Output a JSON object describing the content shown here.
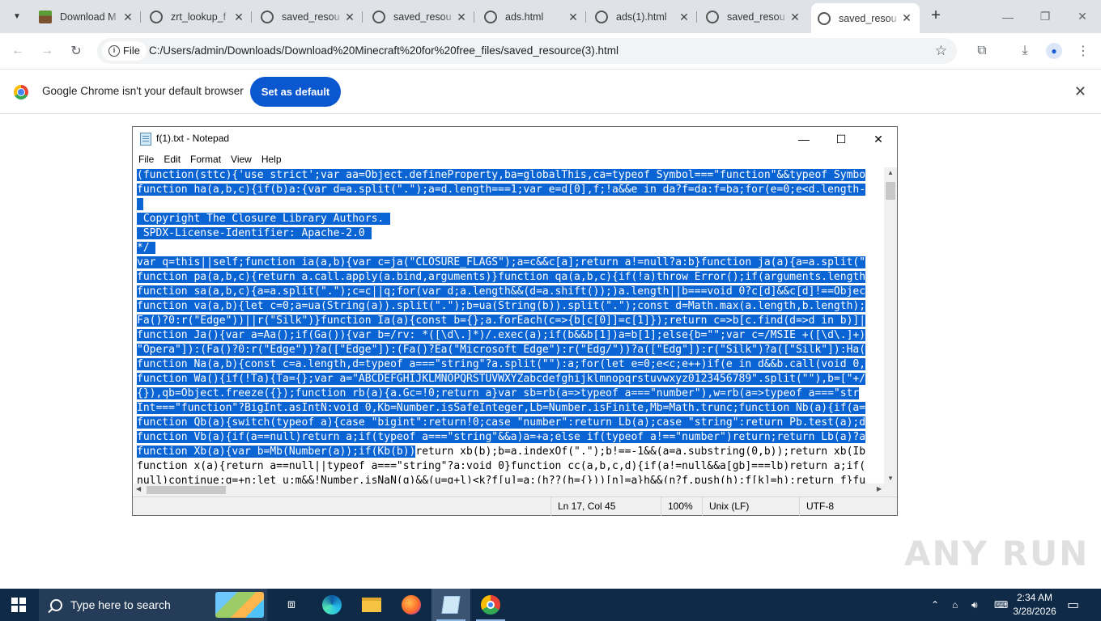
{
  "browser": {
    "tabs": [
      {
        "title": "Download M",
        "icon": "minecraft-icon"
      },
      {
        "title": "zrt_lookup_f",
        "icon": "globe-icon"
      },
      {
        "title": "saved_resou",
        "icon": "globe-icon"
      },
      {
        "title": "saved_resou",
        "icon": "globe-icon"
      },
      {
        "title": "ads.html",
        "icon": "globe-icon"
      },
      {
        "title": "ads(1).html",
        "icon": "globe-icon"
      },
      {
        "title": "saved_resou",
        "icon": "globe-icon"
      },
      {
        "title": "saved_resou",
        "icon": "globe-icon",
        "active": true
      }
    ],
    "omnibox": {
      "scheme_label": "File",
      "url": "C:/Users/admin/Downloads/Download%20Minecraft%20for%20free_files/saved_resource(3).html"
    },
    "infobar": {
      "message": "Google Chrome isn't your default browser",
      "button": "Set as default"
    }
  },
  "notepad": {
    "title": "f(1).txt - Notepad",
    "menu": [
      "File",
      "Edit",
      "Format",
      "View",
      "Help"
    ],
    "lines": [
      {
        "sel": "(function(sttc){'use strict';var aa=Object.defineProperty,ba=globalThis,ca=typeof Symbol===\"function\"&&typeof Symbo",
        "rest": ""
      },
      {
        "sel": "function ha(a,b,c){if(b)a:{var d=a.split(\".\");a=d.length===1;var e=d[0],f;!a&&e in da?f=da:f=ba;for(e=0;e<d.length-",
        "rest": ""
      },
      {
        "sel": " ",
        "rest": ""
      },
      {
        "sel": " Copyright The Closure Library Authors. ",
        "rest": ""
      },
      {
        "sel": " SPDX-License-Identifier: Apache-2.0 ",
        "rest": ""
      },
      {
        "sel": "*/ ",
        "rest": ""
      },
      {
        "sel": "var q=this||self;function ia(a,b){var c=ja(\"CLOSURE_FLAGS\");a=c&&c[a];return a!=null?a:b}function ja(a){a=a.split(\"",
        "rest": ""
      },
      {
        "sel": "function pa(a,b,c){return a.call.apply(a.bind,arguments)}function qa(a,b,c){if(!a)throw Error();if(arguments.length",
        "rest": ""
      },
      {
        "sel": "function sa(a,b,c){a=a.split(\".\");c=c||q;for(var d;a.length&&(d=a.shift());)a.length||b===void 0?c[d]&&c[d]!==Objec",
        "rest": ""
      },
      {
        "sel": "function va(a,b){let c=0;a=ua(String(a)).split(\".\");b=ua(String(b)).split(\".\");const d=Math.max(a.length,b.length);",
        "rest": ""
      },
      {
        "sel": "Fa()?0:r(\"Edge\"))||r(\"Silk\")}function Ia(a){const b={};a.forEach(c=>{b[c[0]]=c[1]});return c=>b[c.find(d=>d in b)]|",
        "rest": ""
      },
      {
        "sel": "function Ja(){var a=Aa();if(Ga()){var b=/rv: *([\\d\\.]*)/.exec(a);if(b&&b[1])a=b[1];else{b=\"\";var c=/MSIE +([\\d\\.]+)",
        "rest": ""
      },
      {
        "sel": "\"Opera\"]):(Fa()?0:r(\"Edge\"))?a([\"Edge\"]):(Fa()?Ea(\"Microsoft Edge\"):r(\"Edg/\"))?a([\"Edg\"]):r(\"Silk\")?a([\"Silk\"]):Ha(",
        "rest": ""
      },
      {
        "sel": "function Na(a,b){const c=a.length,d=typeof a===\"string\"?a.split(\"\"):a;for(let e=0;e<c;e++)if(e in d&&b.call(void 0,",
        "rest": ""
      },
      {
        "sel": "function Wa(){if(!Ta){Ta={};var a=\"ABCDEFGHIJKLMNOPQRSTUVWXYZabcdefghijklmnopqrstuvwxyz0123456789\".split(\"\"),b=[\"+/",
        "rest": ""
      },
      {
        "sel": "{}),qb=Object.freeze({});function rb(a){a.Gc=!0;return a}var sb=rb(a=>typeof a===\"number\"),w=rb(a=>typeof a===\"str",
        "rest": ""
      },
      {
        "sel": "Int===\"function\"?BigInt.asIntN:void 0,Kb=Number.isSafeInteger,Lb=Number.isFinite,Mb=Math.trunc;function Nb(a){if(a=",
        "rest": ""
      },
      {
        "sel": "function Qb(a){switch(typeof a){case \"bigint\":return!0;case \"number\":return Lb(a);case \"string\":return Pb.test(a);d",
        "rest": ""
      },
      {
        "sel": "function Vb(a){if(a==null)return a;if(typeof a===\"string\"&&a)a=+a;else if(typeof a!==\"number\")return;return Lb(a)?a",
        "rest": ""
      },
      {
        "sel": "function Xb(a){var b=Mb(Number(a));if(Kb(b))",
        "rest": "return xb(b);b=a.indexOf(\".\");b!==-1&&(a=a.substring(0,b));return xb(Ib"
      },
      {
        "sel": "",
        "rest": "function x(a){return a==null||typeof a===\"string\"?a:void 0}function cc(a,b,c,d){if(a!=null&&a[gb]===lb)return a;if("
      },
      {
        "sel": "",
        "rest": "null)continue;g=+n;let u;m&&!Number.isNaN(g)&&(u=g+l)<k?f[u]=a:(h??(h={}))[n]=a}h&&(n?f.push(h):f[k]=h);return f}fu"
      }
    ],
    "status": {
      "position": "Ln 17, Col 45",
      "zoom": "100%",
      "eol": "Unix (LF)",
      "encoding": "UTF-8"
    }
  },
  "watermark": "ANY RUN",
  "taskbar": {
    "search_placeholder": "Type here to search",
    "apps": [
      "task-view-icon",
      "edge-icon",
      "file-explorer-icon",
      "firefox-icon",
      "notepad-icon",
      "chrome-icon"
    ],
    "time": "2:34 AM",
    "date": "3/28/2026"
  }
}
